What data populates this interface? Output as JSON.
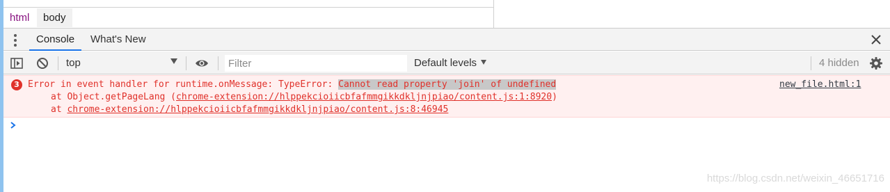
{
  "breadcrumb": {
    "items": [
      "html",
      "body"
    ]
  },
  "drawer": {
    "tabs": [
      "Console",
      "What's New"
    ]
  },
  "toolbar": {
    "context": "top",
    "filter_placeholder": "Filter",
    "levels": "Default levels",
    "hidden": "4 hidden"
  },
  "error": {
    "count": "3",
    "prefix": "Error in event handler for runtime.onMessage: TypeError: ",
    "highlight": "Cannot read property 'join' of undefined",
    "stack1_prefix": "at Object.getPageLang (",
    "stack1_link": "chrome-extension://hlppekcioiicbfafmmgikkdkljnjpiao/content.js:1:8920",
    "stack1_suffix": ")",
    "stack2_prefix": "at ",
    "stack2_link": "chrome-extension://hlppekcioiicbfafmmgikkdkljnjpiao/content.js:8:46945",
    "source": "new_file.html:1"
  },
  "watermark": "https://blog.csdn.net/weixin_46651716",
  "colors": {
    "error_text": "#e0312a",
    "error_bg": "#fff0f0",
    "tab_accent": "#1a73e8",
    "left_accent": "#8fc3ef"
  },
  "icons": [
    "kebab-menu-icon",
    "close-icon",
    "sidebar-toggle-icon",
    "clear-console-icon",
    "dropdown-caret-icon",
    "eye-icon",
    "settings-gear-icon",
    "prompt-chevron-icon"
  ]
}
